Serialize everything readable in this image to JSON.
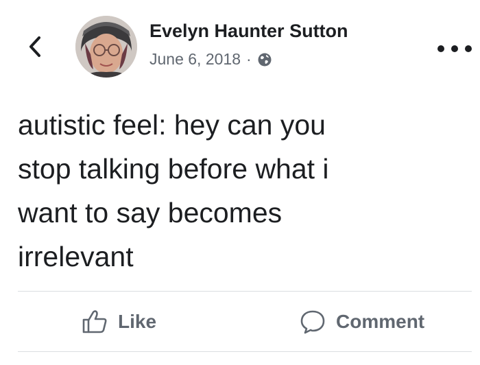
{
  "post": {
    "author": "Evelyn Haunter Sutton",
    "date": "June 6, 2018",
    "separator": "·",
    "privacy_icon": "globe-icon",
    "text_lines": [
      "autistic feel: hey can you",
      "stop talking before what i",
      "want to say becomes",
      "irrelevant"
    ]
  },
  "header": {
    "back_icon": "chevron-left-icon",
    "more_icon": "more-horizontal-icon"
  },
  "actions": {
    "like_label": "Like",
    "like_icon": "thumbs-up-icon",
    "comment_label": "Comment",
    "comment_icon": "comment-bubble-icon"
  },
  "colors": {
    "text": "#1c1e21",
    "secondary_text": "#606770",
    "divider": "#dadde1",
    "background": "#ffffff"
  }
}
